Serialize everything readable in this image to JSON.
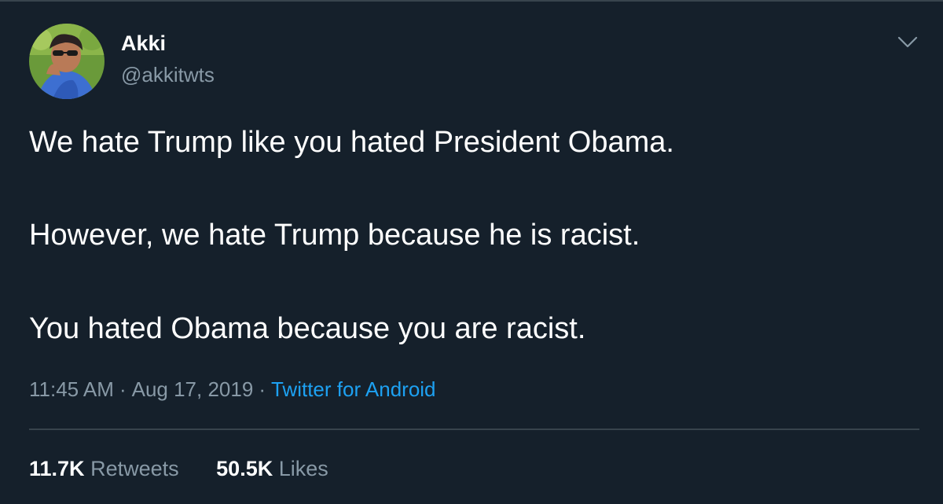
{
  "colors": {
    "background": "#15202b",
    "divider": "#38444d",
    "primary_text": "#ffffff",
    "secondary_text": "#8899a6",
    "link": "#1da1f2"
  },
  "tweet": {
    "author": {
      "display_name": "Akki",
      "handle": "@akkitwts",
      "avatar_icon": "profile-photo"
    },
    "menu_icon": "chevron-down-icon",
    "body_lines": [
      "We hate Trump like you hated President Obama.",
      "However, we hate Trump because he is racist.",
      "You hated Obama because you are racist."
    ],
    "time": "11:45 AM",
    "date": "Aug 17, 2019",
    "separator": "·",
    "source": "Twitter for Android",
    "stats": {
      "retweets_count": "11.7K",
      "retweets_label": "Retweets",
      "likes_count": "50.5K",
      "likes_label": "Likes"
    }
  }
}
